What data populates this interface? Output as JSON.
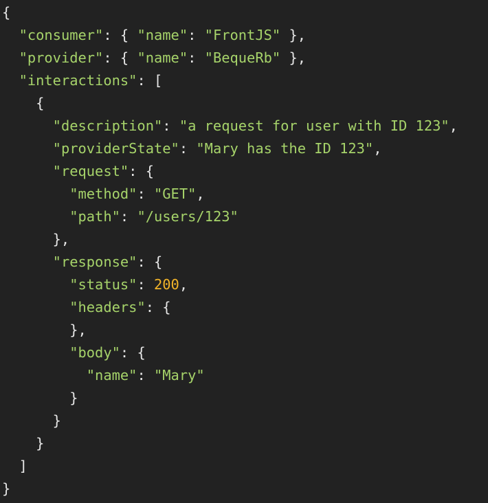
{
  "theme": {
    "background": "#222222",
    "punctuation_color": "#e6e6e6",
    "string_color": "#a6d36a",
    "number_color": "#f2b429"
  },
  "code": {
    "lines": [
      [
        {
          "t": "pun",
          "v": "{"
        }
      ],
      [
        {
          "t": "pun",
          "v": "  "
        },
        {
          "t": "str",
          "v": "\"consumer\""
        },
        {
          "t": "pun",
          "v": ": { "
        },
        {
          "t": "str",
          "v": "\"name\""
        },
        {
          "t": "pun",
          "v": ": "
        },
        {
          "t": "str",
          "v": "\"FrontJS\""
        },
        {
          "t": "pun",
          "v": " },"
        }
      ],
      [
        {
          "t": "pun",
          "v": "  "
        },
        {
          "t": "str",
          "v": "\"provider\""
        },
        {
          "t": "pun",
          "v": ": { "
        },
        {
          "t": "str",
          "v": "\"name\""
        },
        {
          "t": "pun",
          "v": ": "
        },
        {
          "t": "str",
          "v": "\"BequeRb\""
        },
        {
          "t": "pun",
          "v": " },"
        }
      ],
      [
        {
          "t": "pun",
          "v": "  "
        },
        {
          "t": "str",
          "v": "\"interactions\""
        },
        {
          "t": "pun",
          "v": ": ["
        }
      ],
      [
        {
          "t": "pun",
          "v": "    {"
        }
      ],
      [
        {
          "t": "pun",
          "v": "      "
        },
        {
          "t": "str",
          "v": "\"description\""
        },
        {
          "t": "pun",
          "v": ": "
        },
        {
          "t": "str",
          "v": "\"a request for user with ID 123\""
        },
        {
          "t": "pun",
          "v": ","
        }
      ],
      [
        {
          "t": "pun",
          "v": "      "
        },
        {
          "t": "str",
          "v": "\"providerState\""
        },
        {
          "t": "pun",
          "v": ": "
        },
        {
          "t": "str",
          "v": "\"Mary has the ID 123\""
        },
        {
          "t": "pun",
          "v": ","
        }
      ],
      [
        {
          "t": "pun",
          "v": "      "
        },
        {
          "t": "str",
          "v": "\"request\""
        },
        {
          "t": "pun",
          "v": ": {"
        }
      ],
      [
        {
          "t": "pun",
          "v": "        "
        },
        {
          "t": "str",
          "v": "\"method\""
        },
        {
          "t": "pun",
          "v": ": "
        },
        {
          "t": "str",
          "v": "\"GET\""
        },
        {
          "t": "pun",
          "v": ","
        }
      ],
      [
        {
          "t": "pun",
          "v": "        "
        },
        {
          "t": "str",
          "v": "\"path\""
        },
        {
          "t": "pun",
          "v": ": "
        },
        {
          "t": "str",
          "v": "\"/users/123\""
        }
      ],
      [
        {
          "t": "pun",
          "v": "      },"
        }
      ],
      [
        {
          "t": "pun",
          "v": "      "
        },
        {
          "t": "str",
          "v": "\"response\""
        },
        {
          "t": "pun",
          "v": ": {"
        }
      ],
      [
        {
          "t": "pun",
          "v": "        "
        },
        {
          "t": "str",
          "v": "\"status\""
        },
        {
          "t": "pun",
          "v": ": "
        },
        {
          "t": "num",
          "v": "200"
        },
        {
          "t": "pun",
          "v": ","
        }
      ],
      [
        {
          "t": "pun",
          "v": "        "
        },
        {
          "t": "str",
          "v": "\"headers\""
        },
        {
          "t": "pun",
          "v": ": {"
        }
      ],
      [
        {
          "t": "pun",
          "v": "        },"
        }
      ],
      [
        {
          "t": "pun",
          "v": "        "
        },
        {
          "t": "str",
          "v": "\"body\""
        },
        {
          "t": "pun",
          "v": ": {"
        }
      ],
      [
        {
          "t": "pun",
          "v": "          "
        },
        {
          "t": "str",
          "v": "\"name\""
        },
        {
          "t": "pun",
          "v": ": "
        },
        {
          "t": "str",
          "v": "\"Mary\""
        }
      ],
      [
        {
          "t": "pun",
          "v": "        }"
        }
      ],
      [
        {
          "t": "pun",
          "v": "      }"
        }
      ],
      [
        {
          "t": "pun",
          "v": "    }"
        }
      ],
      [
        {
          "t": "pun",
          "v": "  ]"
        }
      ],
      [
        {
          "t": "pun",
          "v": "}"
        }
      ]
    ]
  }
}
